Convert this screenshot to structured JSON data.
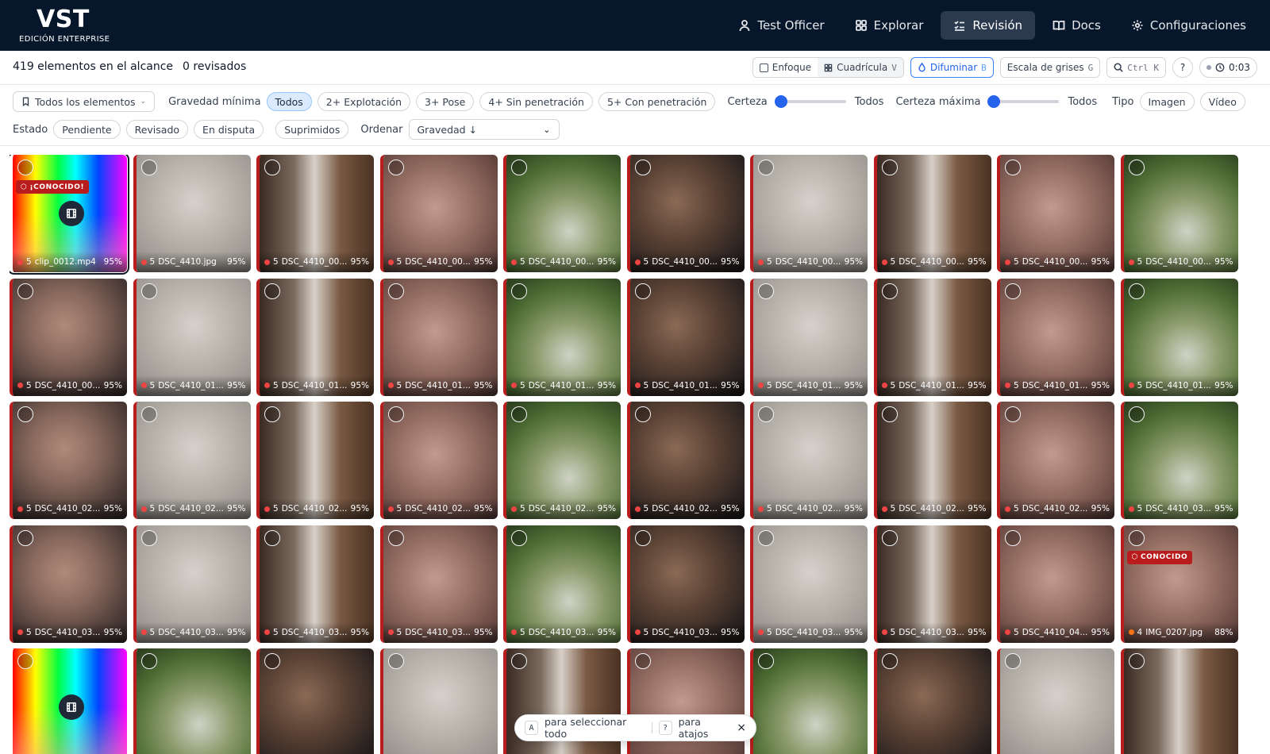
{
  "brand": {
    "logo": "VST",
    "edition": "EDICIÓN ENTERPRISE"
  },
  "nav": [
    {
      "label": "Test Officer",
      "icon": "user-icon",
      "active": false
    },
    {
      "label": "Explorar",
      "icon": "grid-icon",
      "active": false
    },
    {
      "label": "Revisión",
      "icon": "checklist-icon",
      "active": true
    },
    {
      "label": "Docs",
      "icon": "book-icon",
      "active": false
    },
    {
      "label": "Configuraciones",
      "icon": "gear-icon",
      "active": false
    }
  ],
  "status": {
    "scope_count": "419 elementos en el alcance",
    "reviewed": "0 revisados",
    "focus_label": "Enfoque",
    "grid_label": "Cuadrícula",
    "grid_key": "V",
    "blur_label": "Difuminar",
    "blur_key": "B",
    "gray_label": "Escala de grises",
    "gray_key": "G",
    "search_key": "Ctrl K",
    "help_label": "?",
    "timer": "0:03"
  },
  "filters": {
    "scope_dropdown": "Todos los elementos",
    "min_severity_label": "Gravedad mínima",
    "severity_options": [
      "Todos",
      "2+ Explotación",
      "3+ Pose",
      "4+ Sin penetración",
      "5+ Con penetración"
    ],
    "severity_selected": "Todos",
    "certainty_label": "Certeza",
    "certainty_value": "Todos",
    "certainty_level": 0,
    "max_certainty_label": "Certeza máxima",
    "max_certainty_value": "Todos",
    "max_certainty_level": 0,
    "type_label": "Tipo",
    "type_options": [
      "Imagen",
      "Vídeo"
    ],
    "state_label": "Estado",
    "state_options": [
      "Pendiente",
      "Revisado",
      "En disputa"
    ],
    "suppressed_label": "Suprimidos",
    "sort_label": "Ordenar",
    "sort_value": "Gravedad ↓"
  },
  "tiles": [
    {
      "sev": "5",
      "name": "clip_0012.mp4",
      "conf": "95%",
      "thumb": "rainbow",
      "video": true,
      "badge": "¡CONOCIDO!",
      "selected": true
    },
    {
      "sev": "5",
      "name": "DSC_4410.jpg",
      "conf": "95%",
      "thumb": "grey"
    },
    {
      "sev": "5",
      "name": "DSC_4410_00...",
      "conf": "95%",
      "thumb": "tree"
    },
    {
      "sev": "5",
      "name": "DSC_4410_00...",
      "conf": "95%",
      "thumb": "pink"
    },
    {
      "sev": "5",
      "name": "DSC_4410_00...",
      "conf": "95%",
      "thumb": "green"
    },
    {
      "sev": "5",
      "name": "DSC_4410_00...",
      "conf": "95%",
      "thumb": "dark"
    },
    {
      "sev": "5",
      "name": "DSC_4410_00...",
      "conf": "95%",
      "thumb": "grey"
    },
    {
      "sev": "5",
      "name": "DSC_4410_00...",
      "conf": "95%",
      "thumb": "tree"
    },
    {
      "sev": "5",
      "name": "DSC_4410_00...",
      "conf": "95%",
      "thumb": "pink"
    },
    {
      "sev": "5",
      "name": "DSC_4410_00...",
      "conf": "95%",
      "thumb": "green"
    },
    {
      "sev": "5",
      "name": "DSC_4410_00...",
      "conf": "95%",
      "thumb": "skin"
    },
    {
      "sev": "5",
      "name": "DSC_4410_01...",
      "conf": "95%",
      "thumb": "grey"
    },
    {
      "sev": "5",
      "name": "DSC_4410_01...",
      "conf": "95%",
      "thumb": "tree"
    },
    {
      "sev": "5",
      "name": "DSC_4410_01...",
      "conf": "95%",
      "thumb": "pink"
    },
    {
      "sev": "5",
      "name": "DSC_4410_01...",
      "conf": "95%",
      "thumb": "green"
    },
    {
      "sev": "5",
      "name": "DSC_4410_01...",
      "conf": "95%",
      "thumb": "dark"
    },
    {
      "sev": "5",
      "name": "DSC_4410_01...",
      "conf": "95%",
      "thumb": "grey"
    },
    {
      "sev": "5",
      "name": "DSC_4410_01...",
      "conf": "95%",
      "thumb": "tree"
    },
    {
      "sev": "5",
      "name": "DSC_4410_01...",
      "conf": "95%",
      "thumb": "pink"
    },
    {
      "sev": "5",
      "name": "DSC_4410_01...",
      "conf": "95%",
      "thumb": "green"
    },
    {
      "sev": "5",
      "name": "DSC_4410_02...",
      "conf": "95%",
      "thumb": "skin"
    },
    {
      "sev": "5",
      "name": "DSC_4410_02...",
      "conf": "95%",
      "thumb": "grey"
    },
    {
      "sev": "5",
      "name": "DSC_4410_02...",
      "conf": "95%",
      "thumb": "tree"
    },
    {
      "sev": "5",
      "name": "DSC_4410_02...",
      "conf": "95%",
      "thumb": "pink"
    },
    {
      "sev": "5",
      "name": "DSC_4410_02...",
      "conf": "95%",
      "thumb": "green"
    },
    {
      "sev": "5",
      "name": "DSC_4410_02...",
      "conf": "95%",
      "thumb": "dark"
    },
    {
      "sev": "5",
      "name": "DSC_4410_02...",
      "conf": "95%",
      "thumb": "grey"
    },
    {
      "sev": "5",
      "name": "DSC_4410_02...",
      "conf": "95%",
      "thumb": "tree"
    },
    {
      "sev": "5",
      "name": "DSC_4410_02...",
      "conf": "95%",
      "thumb": "pink"
    },
    {
      "sev": "5",
      "name": "DSC_4410_03...",
      "conf": "95%",
      "thumb": "green"
    },
    {
      "sev": "5",
      "name": "DSC_4410_03...",
      "conf": "95%",
      "thumb": "skin"
    },
    {
      "sev": "5",
      "name": "DSC_4410_03...",
      "conf": "95%",
      "thumb": "grey"
    },
    {
      "sev": "5",
      "name": "DSC_4410_03...",
      "conf": "95%",
      "thumb": "tree"
    },
    {
      "sev": "5",
      "name": "DSC_4410_03...",
      "conf": "95%",
      "thumb": "pink"
    },
    {
      "sev": "5",
      "name": "DSC_4410_03...",
      "conf": "95%",
      "thumb": "green"
    },
    {
      "sev": "5",
      "name": "DSC_4410_03...",
      "conf": "95%",
      "thumb": "dark"
    },
    {
      "sev": "5",
      "name": "DSC_4410_03...",
      "conf": "95%",
      "thumb": "grey"
    },
    {
      "sev": "5",
      "name": "DSC_4410_03...",
      "conf": "95%",
      "thumb": "tree"
    },
    {
      "sev": "5",
      "name": "DSC_4410_04...",
      "conf": "95%",
      "thumb": "pink"
    },
    {
      "sev": "4",
      "name": "IMG_0207.jpg",
      "conf": "88%",
      "thumb": "pink",
      "badge": "CONOCIDO",
      "orange": true
    },
    {
      "sev": "",
      "name": "",
      "conf": "",
      "thumb": "rainbow",
      "video": true
    },
    {
      "sev": "",
      "name": "",
      "conf": "",
      "thumb": "green"
    },
    {
      "sev": "",
      "name": "",
      "conf": "",
      "thumb": "dark"
    },
    {
      "sev": "",
      "name": "",
      "conf": "",
      "thumb": "grey"
    },
    {
      "sev": "",
      "name": "",
      "conf": "",
      "thumb": "tree"
    },
    {
      "sev": "",
      "name": "",
      "conf": "",
      "thumb": "pink"
    },
    {
      "sev": "",
      "name": "",
      "conf": "",
      "thumb": "green"
    },
    {
      "sev": "",
      "name": "",
      "conf": "",
      "thumb": "dark"
    },
    {
      "sev": "",
      "name": "",
      "conf": "",
      "thumb": "grey"
    },
    {
      "sev": "",
      "name": "",
      "conf": "",
      "thumb": "tree"
    }
  ],
  "hint": {
    "key_a": "A",
    "text_a": "para seleccionar todo",
    "key_q": "?",
    "text_q": "para atajos",
    "close": "×"
  }
}
